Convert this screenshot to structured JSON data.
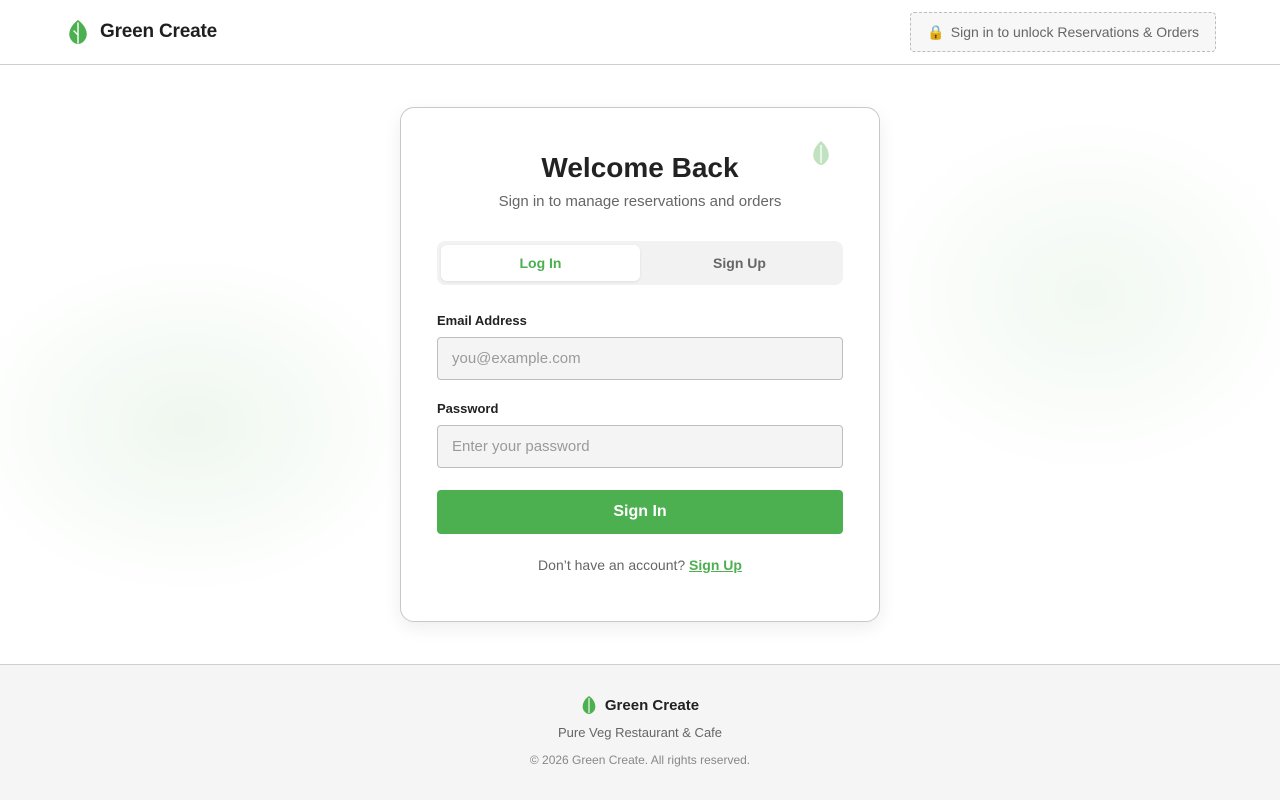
{
  "header": {
    "brand_name": "Green Create",
    "brand_icon": "leaf-icon",
    "unlock_icon": "lock-icon",
    "unlock_label": "Sign in to unlock Reservations & Orders"
  },
  "card": {
    "decor_icon": "leaf-icon",
    "title": "Welcome Back",
    "subtitle": "Sign in to manage reservations and orders",
    "tabs": [
      {
        "label": "Log In",
        "active": true
      },
      {
        "label": "Sign Up",
        "active": false
      }
    ],
    "email": {
      "label": "Email Address",
      "placeholder": "you@example.com",
      "value": ""
    },
    "password": {
      "label": "Password",
      "placeholder": "Enter your password",
      "value": ""
    },
    "submit_label": "Sign In",
    "switch_prompt": "Don’t have an account?",
    "switch_link": "Sign Up"
  },
  "footer": {
    "brand_name": "Green Create",
    "tagline": "Pure Veg Restaurant & Cafe",
    "copyright": "© 2026 Green Create. All rights reserved."
  },
  "colors": {
    "accent": "#4caf50",
    "text": "#222222",
    "muted": "#666666"
  }
}
